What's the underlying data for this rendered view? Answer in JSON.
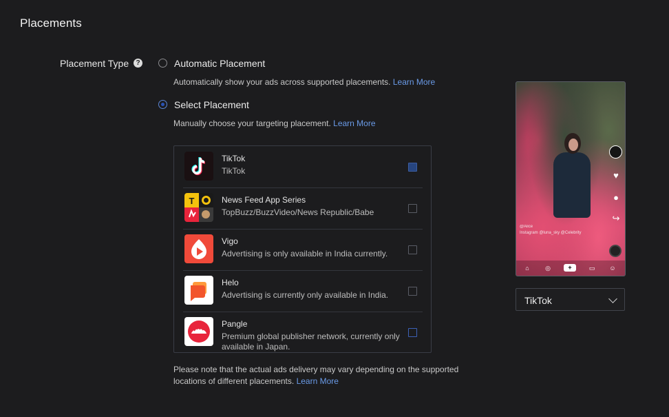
{
  "section_title": "Placements",
  "placement_type": {
    "label": "Placement Type",
    "help_glyph": "?",
    "options": [
      {
        "label": "Automatic Placement",
        "description": "Automatically show your ads across supported placements.",
        "link": "Learn More",
        "selected": false
      },
      {
        "label": "Select Placement",
        "description": "Manually choose your targeting placement.",
        "link": "Learn More",
        "selected": true
      }
    ]
  },
  "placements": [
    {
      "name": "TikTok",
      "subtitle": "TikTok",
      "icon": "tiktok-logo-icon",
      "checked": true
    },
    {
      "name": "News Feed App Series",
      "subtitle": "TopBuzz/BuzzVideo/News Republic/Babe",
      "icon": "news-feed-app-series-icon",
      "checked": false
    },
    {
      "name": "Vigo",
      "subtitle": "Advertising is only available in India currently.",
      "icon": "vigo-logo-icon",
      "checked": false
    },
    {
      "name": "Helo",
      "subtitle": "Advertising is currently only available in India.",
      "icon": "helo-logo-icon",
      "checked": false
    },
    {
      "name": "Pangle",
      "subtitle": "Premium global publisher network, currently only available in Japan.",
      "icon": "pangle-logo-icon",
      "checked": false
    }
  ],
  "note": {
    "text": "Please note that the actual ads delivery may vary depending on the supported locations of different placements.",
    "link": "Learn More"
  },
  "preview": {
    "caption_handle": "@Alice",
    "caption_line": "Instagram @luna_sky @Celebrity",
    "selected_placement": "TikTok"
  },
  "colors": {
    "background": "#1c1c1e",
    "link": "#6a9be8",
    "radio_selected": "#2a53b5",
    "checkbox_checked": "#27457f"
  }
}
